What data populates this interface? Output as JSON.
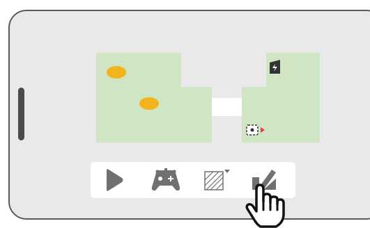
{
  "device": {
    "frame": "tablet-landscape"
  },
  "map": {
    "rooms": [
      {
        "name": "room-left",
        "color": "#cfe5c3"
      },
      {
        "name": "room-right",
        "color": "#cfe5c3"
      }
    ],
    "hallway_color": "#ffffff",
    "objects": [
      {
        "name": "orange-spot-1",
        "color": "#f3b31c"
      },
      {
        "name": "orange-spot-2",
        "color": "#f3b31c"
      },
      {
        "name": "charging-dock-icon"
      },
      {
        "name": "robot-vacuum-icon",
        "direction_color": "#e8433a"
      }
    ]
  },
  "toolbar": {
    "tools": [
      {
        "name": "play-icon",
        "color": "#707070"
      },
      {
        "name": "gamepad-icon",
        "color": "#707070"
      },
      {
        "name": "no-go-zone-icon",
        "color": "#707070"
      },
      {
        "name": "edit-map-icon",
        "color": "#707070"
      }
    ]
  },
  "gesture": {
    "name": "tap-hand-icon"
  }
}
